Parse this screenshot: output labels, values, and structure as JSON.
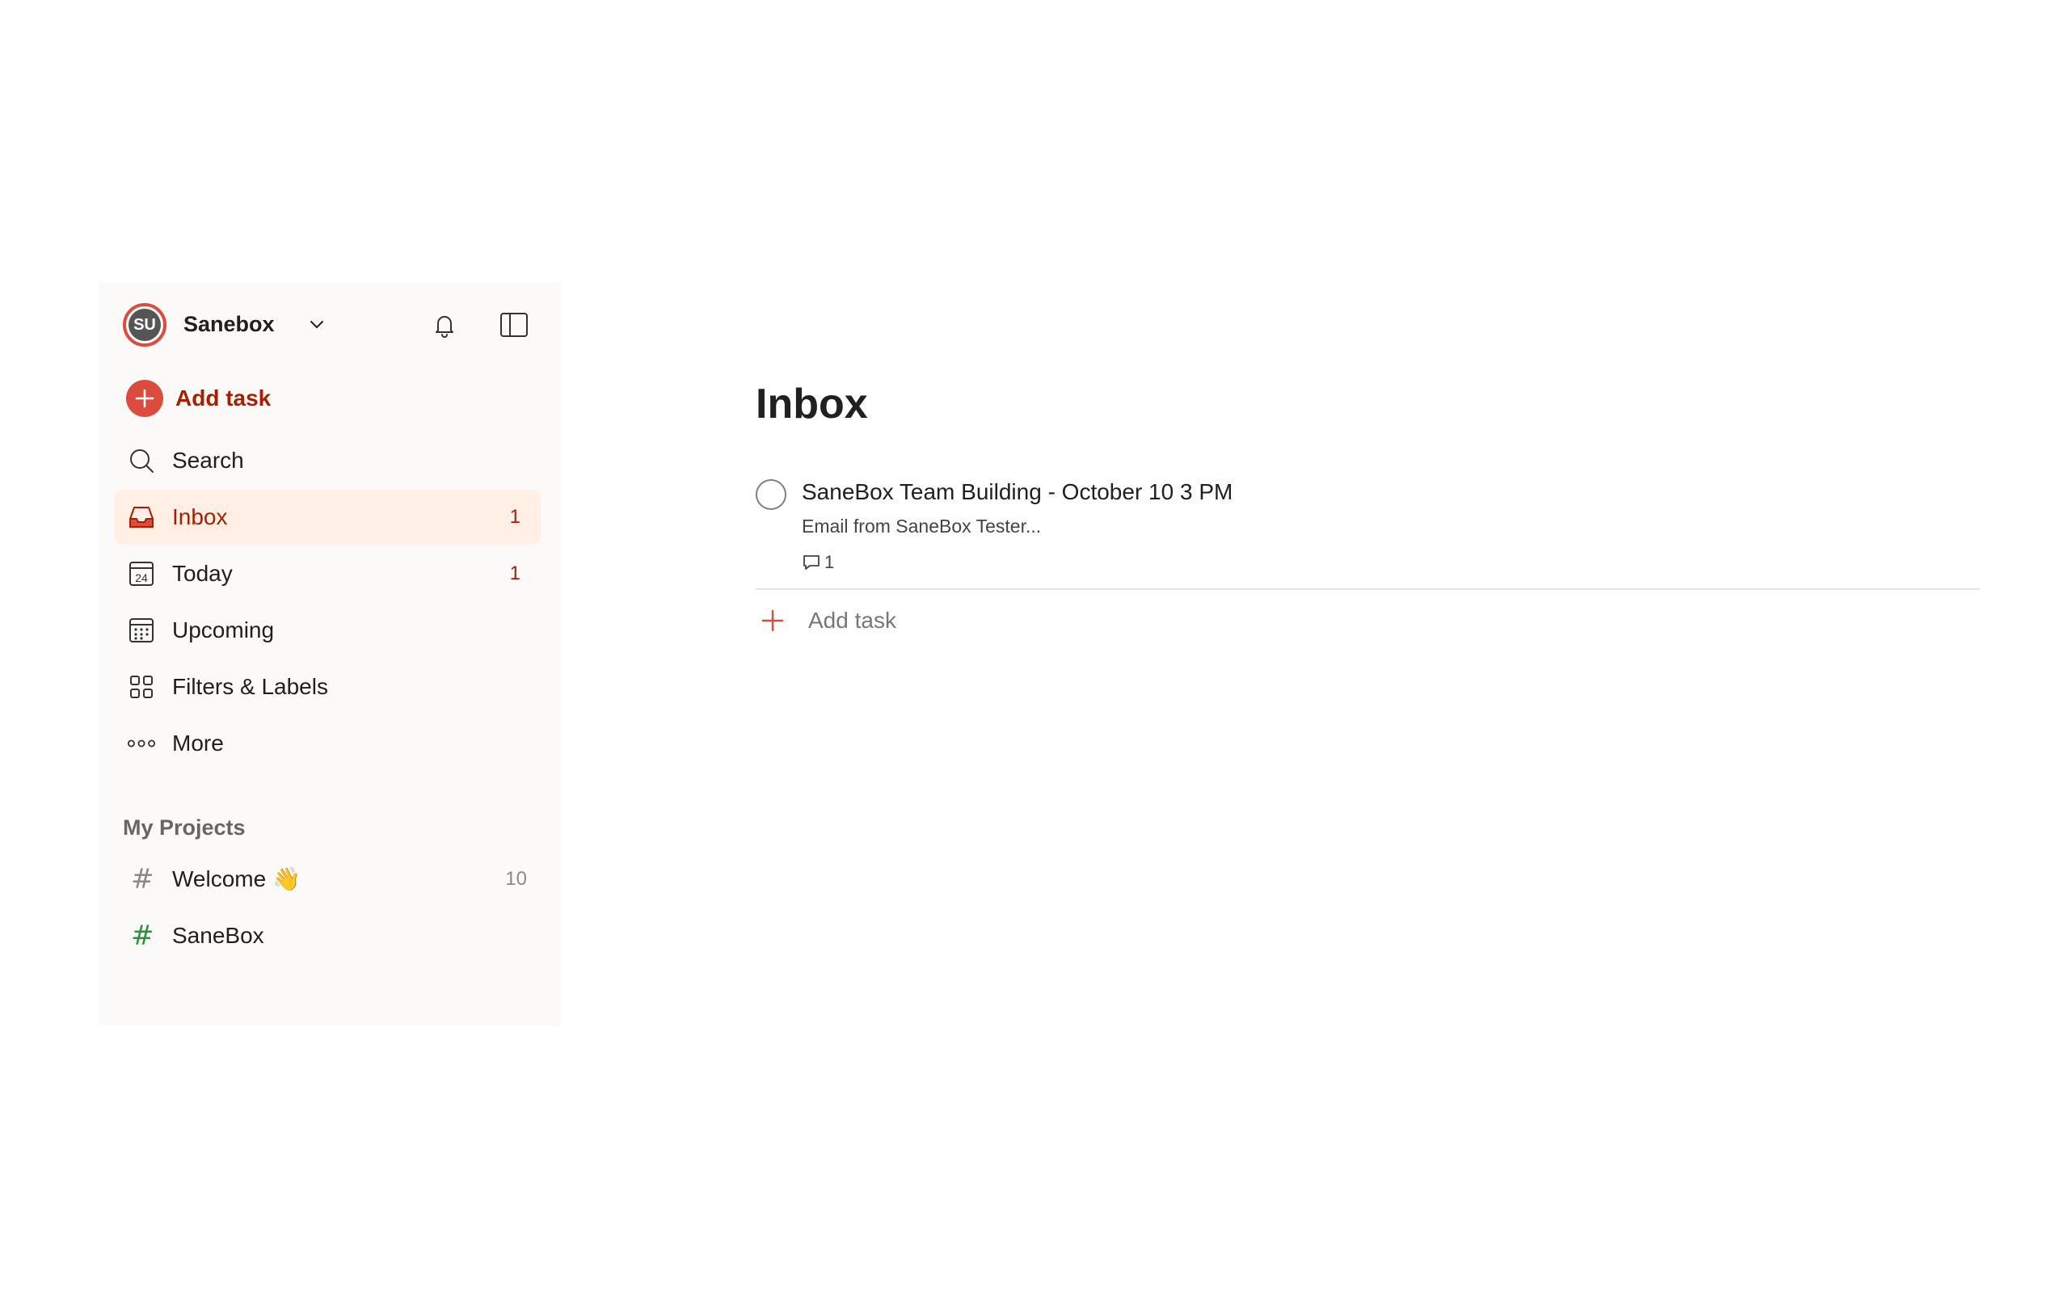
{
  "workspace": {
    "avatar_initials": "SU",
    "name": "Sanebox"
  },
  "sidebar": {
    "add_task_label": "Add task",
    "nav": [
      {
        "label": "Search",
        "icon": "search-icon",
        "count": ""
      },
      {
        "label": "Inbox",
        "icon": "inbox-icon",
        "count": "1",
        "active": true
      },
      {
        "label": "Today",
        "icon": "calendar-today-icon",
        "count": "1",
        "calendar_day": "24"
      },
      {
        "label": "Upcoming",
        "icon": "calendar-upcoming-icon",
        "count": ""
      },
      {
        "label": "Filters & Labels",
        "icon": "filters-icon",
        "count": ""
      },
      {
        "label": "More",
        "icon": "more-icon",
        "count": ""
      }
    ],
    "projects_title": "My Projects",
    "projects": [
      {
        "label": "Welcome 👋",
        "count": "10",
        "color": "#8a8a8a"
      },
      {
        "label": "SaneBox",
        "count": "",
        "color": "#299438"
      }
    ]
  },
  "main": {
    "title": "Inbox",
    "tasks": [
      {
        "title": "SaneBox Team Building - October 10 3 PM",
        "description": "Email from SaneBox Tester...",
        "comment_count": "1"
      }
    ],
    "add_task_label": "Add task"
  },
  "colors": {
    "accent": "#dc4c3e",
    "accent_text": "#a81f00",
    "active_bg": "#ffefe5",
    "sidebar_bg": "#fcfaf8"
  }
}
